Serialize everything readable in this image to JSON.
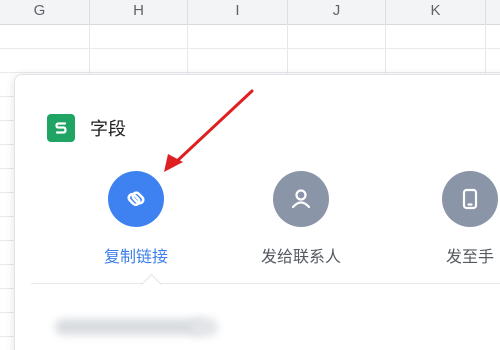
{
  "spreadsheet": {
    "columns": [
      "G",
      "H",
      "I",
      "J",
      "K"
    ]
  },
  "share_panel": {
    "file_name": "字段",
    "file_icon": "spreadsheet-file-icon",
    "actions": [
      {
        "label": "复制链接",
        "icon": "link-icon",
        "color": "#3d82f0",
        "active": true
      },
      {
        "label": "发给联系人",
        "icon": "person-icon",
        "color": "#8a95a8",
        "active": false
      },
      {
        "label": "发至手",
        "icon": "phone-icon",
        "color": "#8a95a8",
        "active": false
      }
    ]
  },
  "annotation": {
    "arrow_color": "#e02020"
  }
}
